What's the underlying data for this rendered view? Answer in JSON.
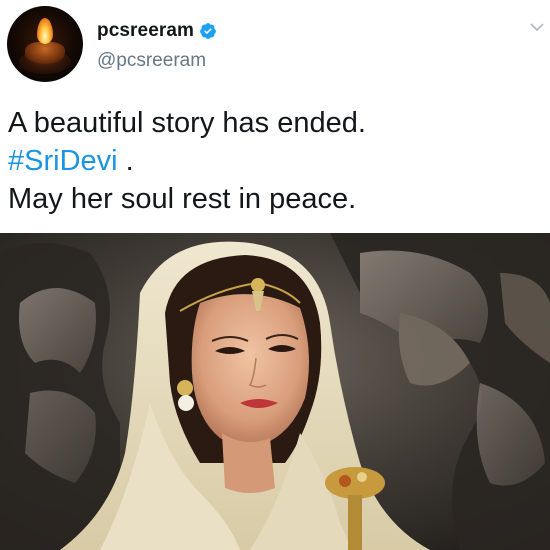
{
  "tweet": {
    "display_name": "pcsreeram",
    "handle": "@pcsreeram",
    "verified": true,
    "text_line1": "A beautiful story has ended.",
    "hashtag": "#SriDevi",
    "text_after_hashtag": " .",
    "text_line3": "May her soul rest in peace."
  },
  "icons": {
    "avatar": "diya-lamp-avatar-icon",
    "verified": "verified-badge-icon",
    "more": "chevron-down-icon"
  },
  "colors": {
    "hashtag": "#1b95e0",
    "verified": "#1da1f2",
    "handle": "#657786",
    "text": "#14171a"
  }
}
